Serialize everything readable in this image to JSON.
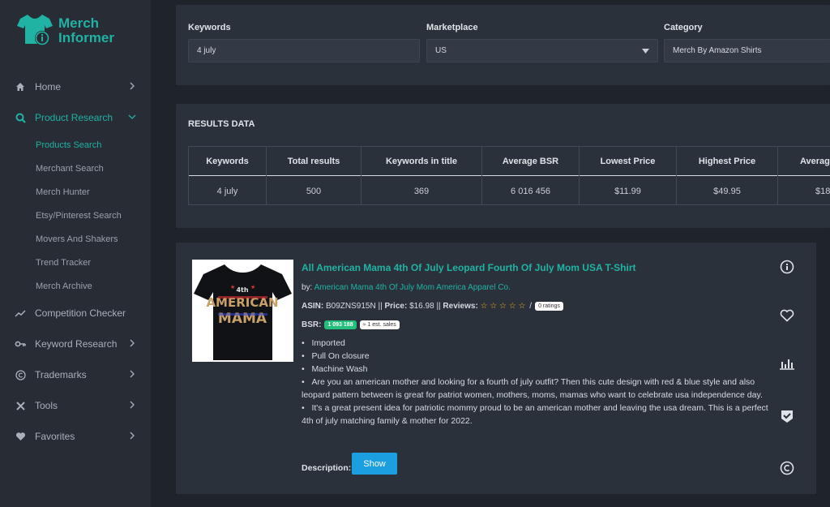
{
  "brand": {
    "line1": "Merch",
    "line2": "Informer"
  },
  "sidebar": {
    "items": [
      {
        "label": "Home",
        "icon": "home-icon"
      },
      {
        "label": "Product Research",
        "icon": "search-icon"
      },
      {
        "label": "Competition Checker",
        "icon": "trend-icon"
      },
      {
        "label": "Keyword Research",
        "icon": "key-icon"
      },
      {
        "label": "Trademarks",
        "icon": "copyright-icon"
      },
      {
        "label": "Tools",
        "icon": "tools-icon"
      },
      {
        "label": "Favorites",
        "icon": "heart-icon"
      }
    ],
    "sub_items": [
      "Products Search",
      "Merchant Search",
      "Merch Hunter",
      "Etsy/Pinterest Search",
      "Movers And Shakers",
      "Trend Tracker",
      "Merch Archive"
    ]
  },
  "filters": {
    "keywords_label": "Keywords",
    "keywords_value": "4 july",
    "marketplace_label": "Marketplace",
    "marketplace_value": "US",
    "category_label": "Category",
    "category_value": "Merch By Amazon Shirts"
  },
  "results": {
    "title": "RESULTS DATA",
    "headers": [
      "Keywords",
      "Total results",
      "Keywords in title",
      "Average BSR",
      "Lowest Price",
      "Highest Price",
      "Averag"
    ],
    "row": [
      "4 july",
      "500",
      "369",
      "6 016 456",
      "$11.99",
      "$49.95",
      "$18"
    ]
  },
  "product": {
    "title": "All American Mama 4th Of July Leopard Fourth Of July Mom USA T-Shirt",
    "by_label": "by:",
    "brand": "American Mama 4th Of July Mom America Apparel Co.",
    "asin_label": "ASIN:",
    "asin": "B09ZNS915N",
    "sep1": "||",
    "price_label": "Price:",
    "price": "$16.98",
    "sep2": "||",
    "reviews_label": "Reviews:",
    "stars": "☆ ☆ ☆ ☆ ☆",
    "slash": "/",
    "ratings": "0 ratings",
    "bsr_label": "BSR:",
    "bsr": "1 093 188",
    "est_sales": "≈ 1 est. sales",
    "shirt_text": [
      "4th",
      "AMERICAN",
      "MAMA"
    ],
    "bullets": [
      "Imported",
      "Pull On closure",
      "Machine Wash",
      "Are you an american mother and looking for a fourth of july outfit? Then this cute design with red & blue style and also leopard pattern between is great for patriot women, mothers, moms, mamas who want to celebrate usa independence day.",
      "It's a great present idea for patriotic mommy proud to be an american mother and leaving the usa dream. This is a perfect 4th of july matching family & mother for 2022."
    ],
    "description_label": "Description:",
    "show_label": "Show"
  },
  "colors": {
    "accent": "#20b3a4",
    "button": "#1b9fe0",
    "bsr_badge": "#22c07c",
    "star": "#f2b01e"
  }
}
